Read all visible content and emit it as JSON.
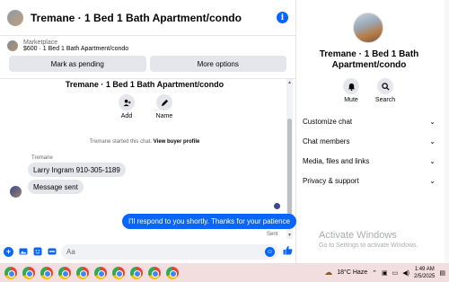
{
  "chat": {
    "header_title": "Tremane · 1 Bed 1 Bath Apartment/condo",
    "marketplace": {
      "label": "Marketplace",
      "listing": "$600 · 1 Bed 1 Bath Apartment/condo",
      "btn_pending": "Mark as pending",
      "btn_more": "More options"
    },
    "convo_title": "Tremane · 1 Bed 1 Bath Apartment/condo",
    "actions": [
      {
        "label": "Add",
        "icon": "add-person-icon"
      },
      {
        "label": "Name",
        "icon": "pencil-icon"
      }
    ],
    "system_text": "Tremane started this chat.",
    "system_link": "View buyer profile",
    "sender_name": "Tremane",
    "incoming": [
      "Larry Ingram 910-305-1189",
      "Message sent"
    ],
    "outgoing": "I'll respond to you shortly. Thanks for your patience",
    "sent_label": "Sent",
    "composer_placeholder": "Aa"
  },
  "info": {
    "title": "Tremane · 1 Bed 1 Bath Apartment/condo",
    "actions": [
      {
        "label": "Mute",
        "icon": "bell-icon"
      },
      {
        "label": "Search",
        "icon": "search-icon"
      }
    ],
    "sections": [
      "Customize chat",
      "Chat members",
      "Media, files and links",
      "Privacy & support"
    ],
    "watermark_title": "Activate Windows",
    "watermark_sub": "Go to Settings to activate Windows."
  },
  "taskbar": {
    "weather": "18°C  Haze",
    "time": "1:49 AM",
    "date": "2/5/2025"
  },
  "colors": {
    "accent": "#0866ff",
    "bubble_in": "#e4e6eb",
    "taskbar": "#f2dede"
  }
}
